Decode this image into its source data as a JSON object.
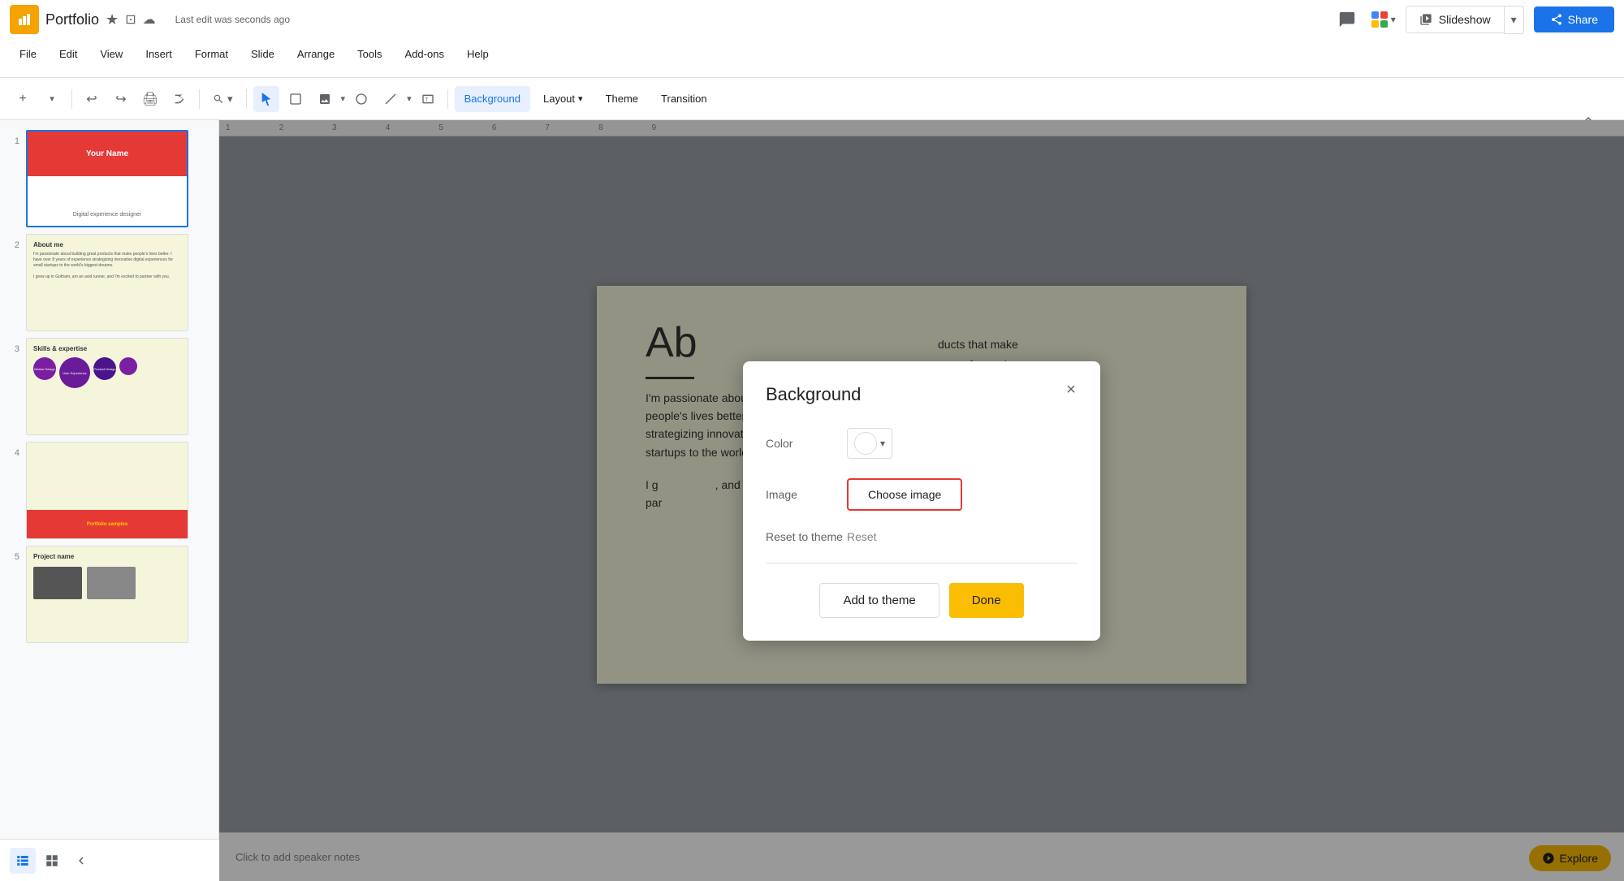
{
  "app": {
    "title": "Portfolio",
    "icon": "📊"
  },
  "titlebar": {
    "doc_title": "Portfolio",
    "last_edit": "Last edit was seconds ago",
    "star_icon": "★",
    "drive_icon": "⊡",
    "cloud_icon": "☁"
  },
  "menu": {
    "items": [
      "File",
      "Edit",
      "View",
      "Insert",
      "Format",
      "Slide",
      "Arrange",
      "Tools",
      "Add-ons",
      "Help"
    ]
  },
  "toolbar": {
    "background_label": "Background",
    "layout_label": "Layout",
    "theme_label": "Theme",
    "transition_label": "Transition"
  },
  "slideshow": {
    "label": "Slideshow"
  },
  "share": {
    "label": "Share"
  },
  "slides": [
    {
      "number": "1",
      "title": "Your Name",
      "subtitle": "Digital experience designer"
    },
    {
      "number": "2",
      "title": "About me"
    },
    {
      "number": "3",
      "title": "Skills & expertise"
    },
    {
      "number": "4",
      "title": "Portfolio samples"
    },
    {
      "number": "5",
      "title": "Project name"
    }
  ],
  "slide_content": {
    "big_text": "Ab",
    "body": "I'm passionate about building great products that make people's lives better. I have over 8 years of experience strategizing innovative digital experiences for small startups to the world's biggest brands.",
    "body2": "I grew up in Gotham, am an avid runner, and I'm excited to partner with you."
  },
  "speaker_notes": {
    "placeholder": "Click to add speaker notes"
  },
  "background_dialog": {
    "title": "Background",
    "color_label": "Color",
    "image_label": "Image",
    "choose_image_label": "Choose image",
    "reset_to_theme_label": "Reset to theme",
    "reset_label": "Reset",
    "add_to_theme_label": "Add to theme",
    "done_label": "Done",
    "close_label": "×"
  },
  "explore": {
    "label": "Explore"
  },
  "ruler": {
    "marks": [
      "1",
      "2",
      "3",
      "4",
      "5"
    ]
  },
  "colors": {
    "accent_red": "#e53935",
    "accent_yellow": "#fbbc04",
    "accent_blue": "#1a73e8",
    "slide_bg": "#f5f5dc",
    "toolbar_bg": "#ffffff"
  }
}
